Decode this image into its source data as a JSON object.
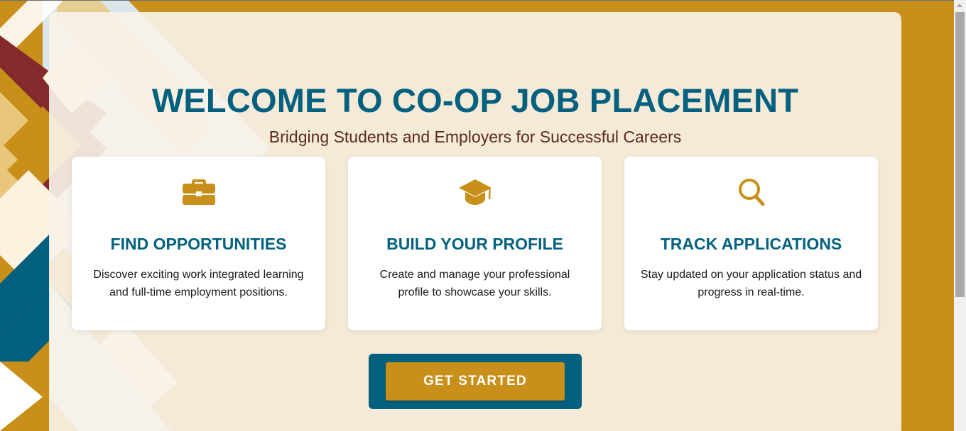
{
  "hero": {
    "title": "WELCOME TO CO-OP JOB PLACEMENT",
    "subtitle": "Bridging Students and Employers for Successful Careers"
  },
  "features": [
    {
      "icon": "briefcase-icon",
      "title": "FIND OPPORTUNITIES",
      "description": "Discover exciting work integrated learning and full-time employment positions."
    },
    {
      "icon": "graduation-cap-icon",
      "title": "BUILD YOUR PROFILE",
      "description": "Create and manage your professional profile to showcase your skills."
    },
    {
      "icon": "search-icon",
      "title": "TRACK APPLICATIONS",
      "description": "Stay updated on your application status and progress in real-time."
    }
  ],
  "cta": {
    "label": "GET STARTED"
  },
  "colors": {
    "background_gold": "#c8901a",
    "heading_teal": "#03617f",
    "subtitle_brown": "#5b2a22",
    "accent_maroon": "#842a2a",
    "panel_cream": "#f8f2e8"
  }
}
